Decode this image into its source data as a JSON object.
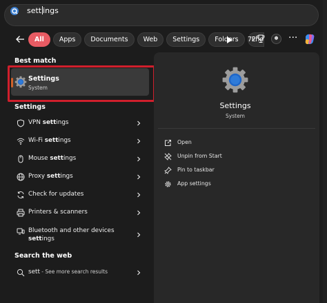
{
  "search": {
    "query_before_caret": "sett",
    "query_after_caret": "ings"
  },
  "filters": {
    "chips": [
      {
        "label": "All",
        "active": true
      },
      {
        "label": "Apps"
      },
      {
        "label": "Documents"
      },
      {
        "label": "Web"
      },
      {
        "label": "Settings"
      },
      {
        "label": "Folders"
      },
      {
        "label": "Pho"
      }
    ],
    "count": "72"
  },
  "best_match": {
    "heading": "Best match",
    "title": "Settings",
    "subtitle": "System"
  },
  "settings_section": {
    "heading": "Settings",
    "items": [
      {
        "pre": "VPN ",
        "bold": "sett",
        "post": "ings",
        "icon": "shield-icon"
      },
      {
        "pre": "Wi-Fi ",
        "bold": "sett",
        "post": "ings",
        "icon": "wifi-icon"
      },
      {
        "pre": "Mouse ",
        "bold": "sett",
        "post": "ings",
        "icon": "mouse-icon"
      },
      {
        "pre": "Proxy ",
        "bold": "sett",
        "post": "ings",
        "icon": "globe-icon"
      },
      {
        "pre": "Check for updates",
        "bold": "",
        "post": "",
        "icon": "sync-icon"
      },
      {
        "pre": "Printers & scanners",
        "bold": "",
        "post": "",
        "icon": "printer-icon"
      },
      {
        "line1": "Bluetooth and other devices",
        "line2_bold": "sett",
        "line2_post": "ings",
        "icon": "bluetooth-icon"
      }
    ]
  },
  "web_section": {
    "heading": "Search the web",
    "query": "sett",
    "suffix": " - See more search results"
  },
  "detail": {
    "title": "Settings",
    "subtitle": "System",
    "actions": [
      {
        "label": "Open",
        "icon": "open-external-icon"
      },
      {
        "label": "Unpin from Start",
        "icon": "unpin-icon"
      },
      {
        "label": "Pin to taskbar",
        "icon": "pin-icon"
      },
      {
        "label": "App settings",
        "icon": "gear-icon"
      }
    ]
  },
  "colors": {
    "accent_chip": "#e85b63",
    "highlight_box": "#d01f2c",
    "selection_accent": "#d0622a",
    "gear_blue": "#2f7bd8"
  }
}
